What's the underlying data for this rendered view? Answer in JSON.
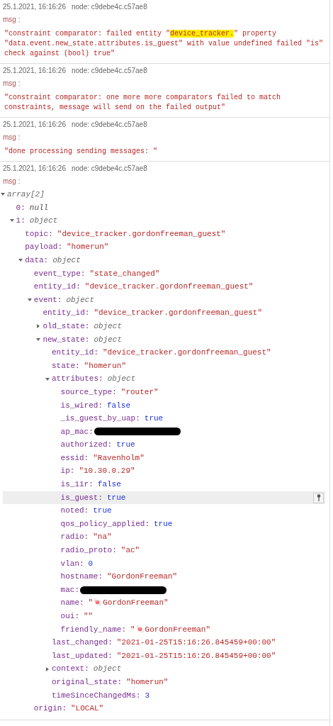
{
  "messages": [
    {
      "time": "25.1.2021, 16:16:26",
      "node": "node: c9debe4c.c57ae8",
      "label": "msg :",
      "kind": "text",
      "parts": [
        {
          "text": "\"constraint comparator: failed entity \"",
          "highlighted": false
        },
        {
          "text": "device_tracker.",
          "highlighted": true
        },
        {
          "text": "\" property \"data.event.new_state.attributes.is_guest\" with value undefined failed \"is\" check against (bool) true\"",
          "highlighted": false
        }
      ]
    },
    {
      "time": "25.1.2021, 16:16:26",
      "node": "node: c9debe4c.c57ae8",
      "label": "msg :",
      "kind": "text",
      "parts": [
        {
          "text": "\"constraint comparator: one more more comparators failed to match constraints, message will send on the failed output\"",
          "highlighted": false
        }
      ]
    },
    {
      "time": "25.1.2021, 16:16:26",
      "node": "node: c9debe4c.c57ae8",
      "label": "msg :",
      "kind": "text",
      "parts": [
        {
          "text": "\"done processing sending messages: \"",
          "highlighted": false
        }
      ]
    },
    {
      "time": "25.1.2021, 16:16:26",
      "node": "node: c9debe4c.c57ae8",
      "label": "msg :",
      "kind": "tree",
      "tree": [
        {
          "value": "array[2]",
          "kind": "type",
          "expanded": true,
          "highlighted": false,
          "children": [
            {
              "key": "0:",
              "value": "null",
              "kind": "null",
              "highlighted": false
            },
            {
              "key": "1:",
              "value": "object",
              "kind": "type",
              "expanded": true,
              "highlighted": false,
              "children": [
                {
                  "key": "topic:",
                  "value": "\"device_tracker.gordonfreeman_guest\"",
                  "kind": "string",
                  "highlighted": false
                },
                {
                  "key": "payload:",
                  "value": "\"homerun\"",
                  "kind": "string",
                  "highlighted": false
                },
                {
                  "key": "data:",
                  "value": "object",
                  "kind": "type",
                  "expanded": true,
                  "highlighted": false,
                  "children": [
                    {
                      "key": "event_type:",
                      "value": "\"state_changed\"",
                      "kind": "string",
                      "highlighted": false
                    },
                    {
                      "key": "entity_id:",
                      "value": "\"device_tracker.gordonfreeman_guest\"",
                      "kind": "string",
                      "highlighted": false
                    },
                    {
                      "key": "event:",
                      "value": "object",
                      "kind": "type",
                      "expanded": true,
                      "highlighted": false,
                      "children": [
                        {
                          "key": "entity_id:",
                          "value": "\"device_tracker.gordonfreeman_guest\"",
                          "kind": "string",
                          "highlighted": false
                        },
                        {
                          "key": "old_state:",
                          "value": "object",
                          "kind": "type",
                          "expanded": false,
                          "highlighted": false
                        },
                        {
                          "key": "new_state:",
                          "value": "object",
                          "kind": "type",
                          "expanded": true,
                          "highlighted": false,
                          "children": [
                            {
                              "key": "entity_id:",
                              "value": "\"device_tracker.gordonfreeman_guest\"",
                              "kind": "string",
                              "highlighted": false
                            },
                            {
                              "key": "state:",
                              "value": "\"homerun\"",
                              "kind": "string",
                              "highlighted": false
                            },
                            {
                              "key": "attributes:",
                              "value": "object",
                              "kind": "type",
                              "expanded": true,
                              "highlighted": false,
                              "children": [
                                {
                                  "key": "source_type:",
                                  "value": "\"router\"",
                                  "kind": "string",
                                  "highlighted": false
                                },
                                {
                                  "key": "is_wired:",
                                  "value": "false",
                                  "kind": "bool",
                                  "highlighted": false
                                },
                                {
                                  "key": "_is_guest_by_uap:",
                                  "value": "true",
                                  "kind": "bool",
                                  "highlighted": false
                                },
                                {
                                  "key": "ap_mac:",
                                  "kind": "redacted",
                                  "highlighted": false
                                },
                                {
                                  "key": "authorized:",
                                  "value": "true",
                                  "kind": "bool",
                                  "highlighted": false
                                },
                                {
                                  "key": "essid:",
                                  "value": "\"Ravenholm\"",
                                  "kind": "string",
                                  "highlighted": false
                                },
                                {
                                  "key": "ip:",
                                  "value": "\"10.30.0.29\"",
                                  "kind": "string",
                                  "highlighted": false
                                },
                                {
                                  "key": "is_11r:",
                                  "value": "false",
                                  "kind": "bool",
                                  "highlighted": false
                                },
                                {
                                  "key": "is_guest:",
                                  "value": "true",
                                  "kind": "bool",
                                  "highlighted": true
                                },
                                {
                                  "key": "noted:",
                                  "value": "true",
                                  "kind": "bool",
                                  "highlighted": false
                                },
                                {
                                  "key": "qos_policy_applied:",
                                  "value": "true",
                                  "kind": "bool",
                                  "highlighted": false
                                },
                                {
                                  "key": "radio:",
                                  "value": "\"na\"",
                                  "kind": "string",
                                  "highlighted": false
                                },
                                {
                                  "key": "radio_proto:",
                                  "value": "\"ac\"",
                                  "kind": "string",
                                  "highlighted": false
                                },
                                {
                                  "key": "vlan:",
                                  "value": "0",
                                  "kind": "number",
                                  "highlighted": false
                                },
                                {
                                  "key": "hostname:",
                                  "value": "\"GordonFreeman\"",
                                  "kind": "string",
                                  "highlighted": false
                                },
                                {
                                  "key": "mac:",
                                  "kind": "redacted",
                                  "highlighted": false
                                },
                                {
                                  "key": "name:",
                                  "value": "\"🍬GordonFreeman\"",
                                  "kind": "string",
                                  "highlighted": false
                                },
                                {
                                  "key": "oui:",
                                  "value": "\"\"",
                                  "kind": "string",
                                  "highlighted": false
                                },
                                {
                                  "key": "friendly_name:",
                                  "value": "\"🍬GordonFreeman\"",
                                  "kind": "string",
                                  "highlighted": false
                                }
                              ]
                            },
                            {
                              "key": "last_changed:",
                              "value": "\"2021-01-25T15:16:26.845459+00:00\"",
                              "kind": "string",
                              "highlighted": false
                            },
                            {
                              "key": "last_updated:",
                              "value": "\"2021-01-25T15:16:26.845459+00:00\"",
                              "kind": "string",
                              "highlighted": false
                            },
                            {
                              "key": "context:",
                              "value": "object",
                              "kind": "type",
                              "expanded": false,
                              "highlighted": false
                            },
                            {
                              "key": "original_state:",
                              "value": "\"homerun\"",
                              "kind": "string",
                              "highlighted": false
                            },
                            {
                              "key": "timeSinceChangedMs:",
                              "value": "3",
                              "kind": "number",
                              "highlighted": false
                            }
                          ]
                        }
                      ]
                    },
                    {
                      "key": "origin:",
                      "value": "\"LOCAL\"",
                      "kind": "string",
                      "highlighted": false
                    }
                  ]
                }
              ]
            }
          ]
        }
      ]
    }
  ]
}
